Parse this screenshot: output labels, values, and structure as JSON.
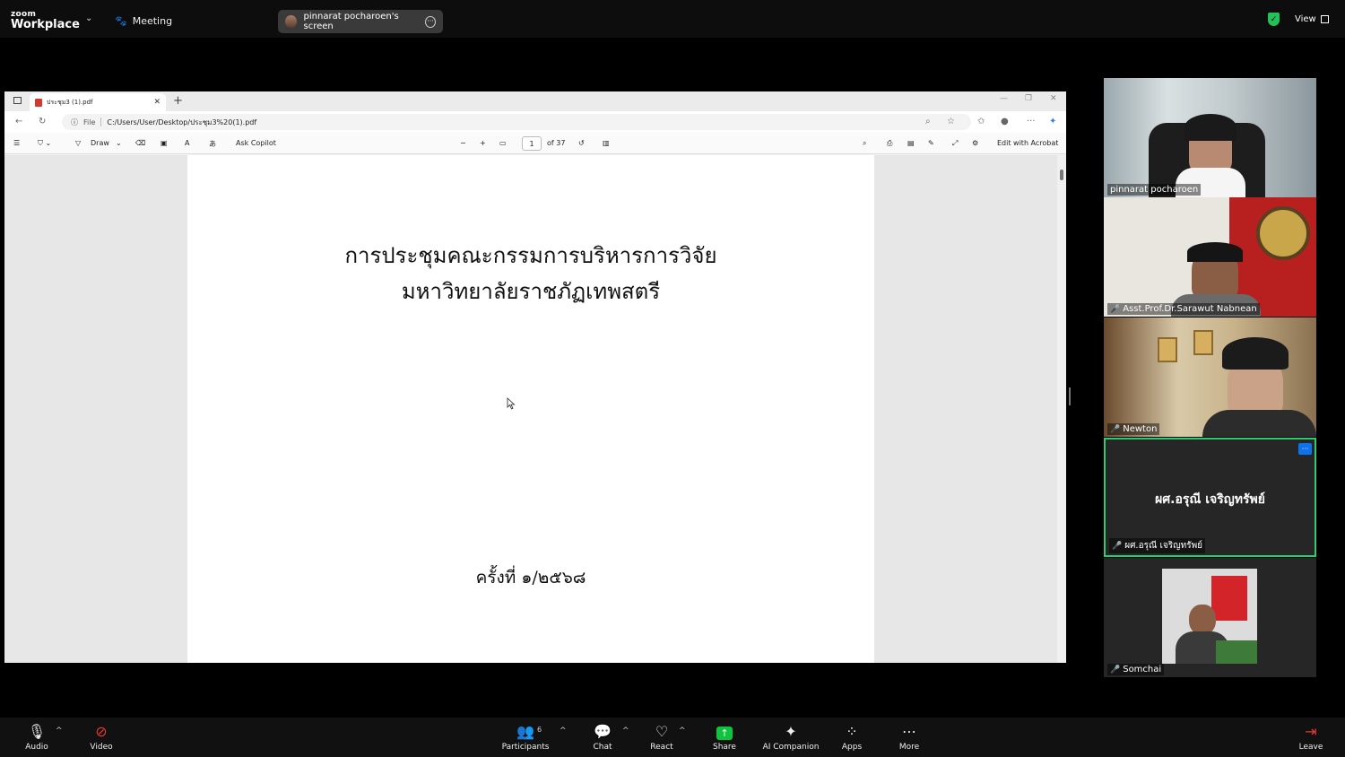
{
  "topbar": {
    "logo_small": "zoom",
    "logo_big": "Workplace",
    "meeting_label": "Meeting",
    "screen_share_label": "pinnarat pocharoen's screen",
    "view_label": "View"
  },
  "browser": {
    "tab_title": "ประชุม3 (1).pdf",
    "address_scheme": "File",
    "address_url": "C:/Users/User/Desktop/ประชุม3%20(1).pdf",
    "toolbar": {
      "draw_label": "Draw",
      "ask_copilot_label": "Ask Copilot",
      "page_number": "1",
      "page_total": "of 37",
      "edit_acrobat_label": "Edit with Acrobat"
    }
  },
  "pdf": {
    "title_line1": "การประชุมคณะกรรมการบริหารการวิจัย",
    "title_line2": "มหาวิทยาลัยราชภัฏเทพสตรี",
    "session": "ครั้งที่ ๑/๒๕๖๘"
  },
  "participants": [
    {
      "name": "pinnarat pocharoen",
      "muted": false
    },
    {
      "name": "Asst.Prof.Dr.Sarawut Nabnean",
      "muted": true
    },
    {
      "name": "Newton",
      "muted": true
    },
    {
      "name": "ผศ.อรุณี เจริญทรัพย์",
      "display": "ผศ.อรุณี เจริญทรัพย์",
      "muted": true
    },
    {
      "name": "Somchai",
      "muted": true
    }
  ],
  "bottombar": {
    "audio": "Audio",
    "video": "Video",
    "participants": "Participants",
    "participants_count": "6",
    "chat": "Chat",
    "react": "React",
    "share": "Share",
    "ai_companion": "AI Companion",
    "apps": "Apps",
    "more": "More",
    "leave": "Leave"
  },
  "colors": {
    "active_speaker": "#2ecc71",
    "share_green": "#0ec33e",
    "muted_red": "#e53935",
    "accent_blue": "#0e72ed"
  }
}
